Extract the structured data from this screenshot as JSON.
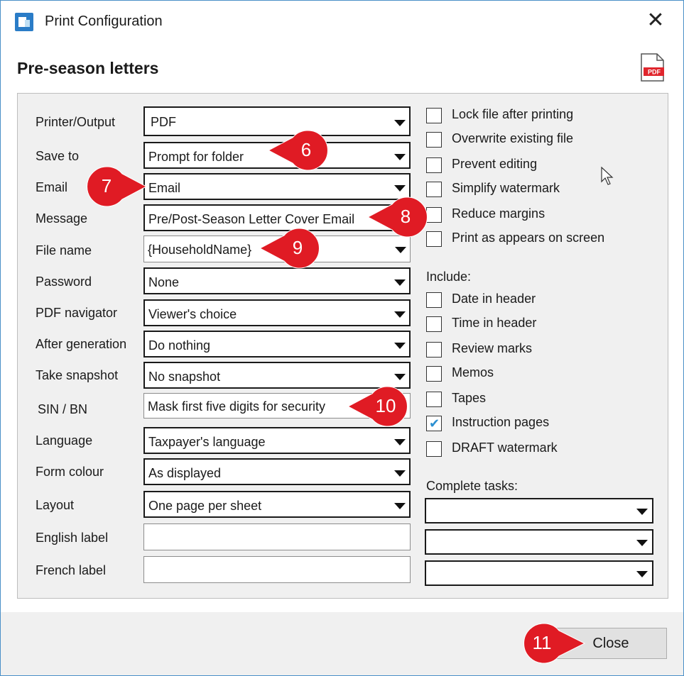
{
  "window": {
    "title": "Print Configuration",
    "heading": "Pre-season letters",
    "close_symbol": "✕",
    "app_icon": "app-icon",
    "pdf_icon": "pdf-file-icon",
    "pdf_icon_text": "PDF"
  },
  "fields": [
    {
      "label": "Printer/Output",
      "value": "PDF"
    },
    {
      "label": "Save to",
      "value": "Prompt for folder"
    },
    {
      "label": "Email",
      "value": "Email"
    },
    {
      "label": "Message",
      "value": "Pre/Post-Season Letter Cover Email"
    },
    {
      "label": "File name",
      "value": "{HouseholdName}"
    },
    {
      "label": "Password",
      "value": "None"
    },
    {
      "label": "PDF navigator",
      "value": "Viewer's choice"
    },
    {
      "label": "After generation",
      "value": "Do nothing"
    },
    {
      "label": "Take snapshot",
      "value": "No snapshot"
    },
    {
      "label": "SIN / BN",
      "value": "Mask first five digits for security"
    },
    {
      "label": "Language",
      "value": "Taxpayer's language"
    },
    {
      "label": "Form colour",
      "value": "As displayed"
    },
    {
      "label": "Layout",
      "value": "One page per sheet"
    },
    {
      "label": "English label",
      "value": ""
    },
    {
      "label": "French label",
      "value": ""
    }
  ],
  "options": [
    {
      "label": "Lock file after printing",
      "checked": false
    },
    {
      "label": "Overwrite existing file",
      "checked": false
    },
    {
      "label": "Prevent editing",
      "checked": false
    },
    {
      "label": "Simplify watermark",
      "checked": false
    },
    {
      "label": "Reduce margins",
      "checked": false
    },
    {
      "label": "Print as appears on screen",
      "checked": false
    }
  ],
  "include": {
    "label": "Include:",
    "items": [
      {
        "label": "Date in header",
        "checked": false
      },
      {
        "label": "Time in header",
        "checked": false
      },
      {
        "label": "Review marks",
        "checked": false
      },
      {
        "label": "Memos",
        "checked": false
      },
      {
        "label": "Tapes",
        "checked": false
      },
      {
        "label": "Instruction pages",
        "checked": true
      },
      {
        "label": "DRAFT watermark",
        "checked": false
      }
    ]
  },
  "complete_tasks": {
    "label": "Complete tasks:",
    "values": [
      "",
      "",
      ""
    ]
  },
  "footer": {
    "close_label": "Close"
  },
  "callouts": [
    "6",
    "7",
    "8",
    "9",
    "10",
    "11"
  ],
  "colors": {
    "callout_red": "#e01b24",
    "check_blue": "#2b8fd1",
    "panel_bg": "#f0f0f0"
  }
}
